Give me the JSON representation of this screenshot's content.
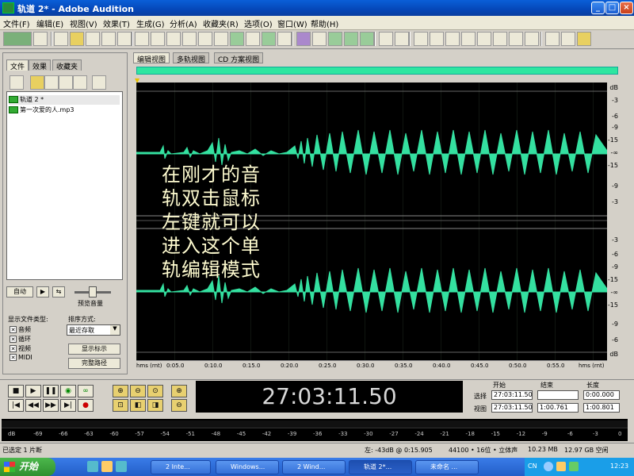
{
  "window": {
    "title": "轨道 2* - Adobe Audition"
  },
  "menu": [
    "文件(F)",
    "编辑(E)",
    "视图(V)",
    "效果(T)",
    "生成(G)",
    "分析(A)",
    "收藏夹(R)",
    "选项(O)",
    "窗口(W)",
    "帮助(H)"
  ],
  "left_panel": {
    "tabs": [
      "文件",
      "效果",
      "收藏夹"
    ],
    "files": [
      "轨道 2 *",
      "第一次爱的人.mp3"
    ],
    "auto_label": "自动",
    "preview_volume": "预览音量",
    "show_types_label": "显示文件类型:",
    "sort_label": "排序方式:",
    "types": [
      "音频",
      "循环",
      "视频",
      "MIDI"
    ],
    "sort_value": "最近存取",
    "show_prompts": "显示标示",
    "full_path": "完整路径"
  },
  "editor": {
    "tabs": [
      "编辑视图",
      "多轨视图",
      "CD 方案视图"
    ],
    "overlay_text": "在刚才的音\n轨双击鼠标\n左键就可以\n进入这个单\n轨编辑模式",
    "db_labels": [
      "dB",
      "-3",
      "-6",
      "-9",
      "-15",
      "-∞",
      "-15",
      "-9",
      "-3",
      "-3",
      "-6",
      "-9",
      "-15",
      "-∞",
      "-15",
      "-9",
      "-6",
      "dB"
    ],
    "time_labels": [
      "hms (rnt)",
      "0:05.0",
      "0:10.0",
      "0:15.0",
      "0:20.0",
      "0:25.0",
      "0:30.0",
      "0:35.0",
      "0:40.0",
      "0:45.0",
      "0:50.0",
      "0:55.0",
      "hms (rnt)"
    ]
  },
  "transport": {
    "time": "27:03:11.50",
    "headers": [
      "开始",
      "结束",
      "长度"
    ],
    "sel_label": "选择",
    "view_label": "视图",
    "sel_start": "27:03:11.50",
    "sel_end": "",
    "sel_len": "0:00.000",
    "view_start": "27:03:11.50",
    "view_end": "1:00.761",
    "view_len": "1:00.801"
  },
  "meter_labels": [
    "dB",
    "-69",
    "-66",
    "-63",
    "-60",
    "-57",
    "-54",
    "-51",
    "-48",
    "-45",
    "-42",
    "-39",
    "-36",
    "-33",
    "-30",
    "-27",
    "-24",
    "-21",
    "-18",
    "-15",
    "-12",
    "-9",
    "-6",
    "-3",
    "0"
  ],
  "status": {
    "left": "已选定 1 片断",
    "level": "左: -43dB @  0:15.905",
    "format": "44100 • 16位 • 立体声",
    "size": "10.23 MB",
    "free": "12.97 GB 空闲"
  },
  "taskbar": {
    "start": "开始",
    "tasks": [
      "2 Inte...",
      "Windows...",
      "2 Wind...",
      "轨道 2*...",
      "未命名 ..."
    ],
    "lang": "CN",
    "clock": "12:23"
  }
}
